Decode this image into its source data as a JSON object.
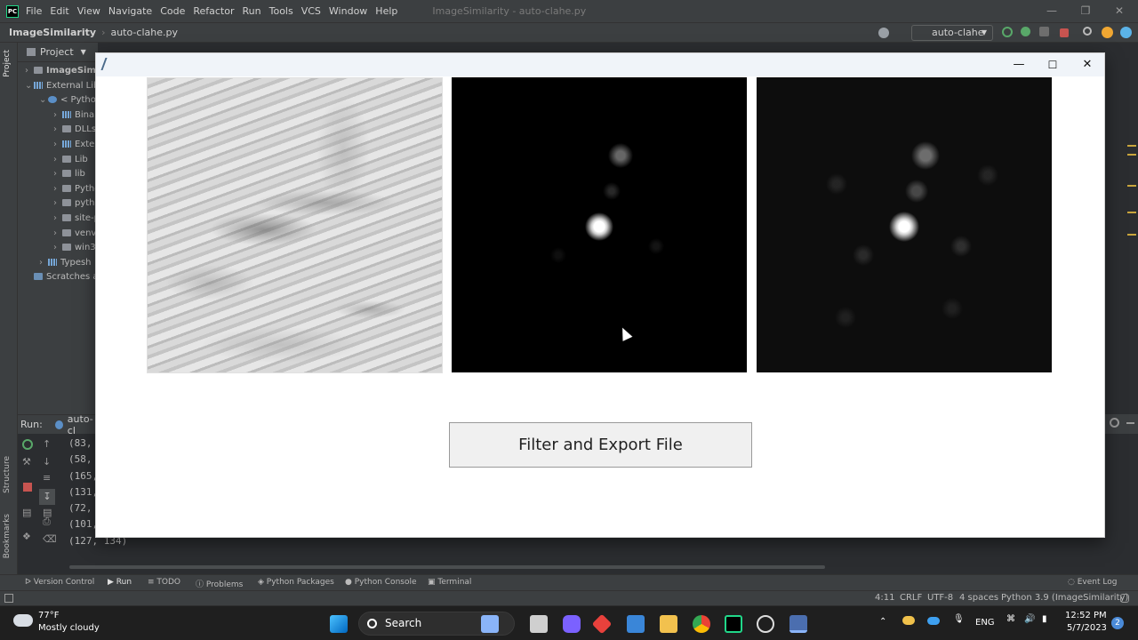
{
  "ide": {
    "menu": [
      "File",
      "Edit",
      "View",
      "Navigate",
      "Code",
      "Refactor",
      "Run",
      "Tools",
      "VCS",
      "Window",
      "Help"
    ],
    "window_title": "ImageSimilarity - auto-clahe.py",
    "breadcrumb_project": "ImageSimilarity",
    "breadcrumb_file": "auto-clahe.py",
    "run_config": "auto-clahe",
    "project_label": "Project",
    "side_tab_project": "Project",
    "side_tab_structure": "Structure",
    "side_tab_bookmarks": "Bookmarks",
    "tree": [
      {
        "label": "ImageSimil",
        "depth": 0,
        "icon": "folder",
        "bold": true
      },
      {
        "label": "External Libr",
        "depth": 0,
        "icon": "lib",
        "open": true
      },
      {
        "label": "< Python",
        "depth": 1,
        "icon": "python",
        "open": true
      },
      {
        "label": "Binar",
        "depth": 2,
        "icon": "lib"
      },
      {
        "label": "DLLs",
        "depth": 2,
        "icon": "folder"
      },
      {
        "label": "Extern",
        "depth": 2,
        "icon": "lib"
      },
      {
        "label": "Lib",
        "depth": 2,
        "icon": "folder"
      },
      {
        "label": "lib",
        "depth": 2,
        "icon": "folder"
      },
      {
        "label": "Pytho",
        "depth": 2,
        "icon": "folder"
      },
      {
        "label": "pytho",
        "depth": 2,
        "icon": "folder"
      },
      {
        "label": "site-p",
        "depth": 2,
        "icon": "folder"
      },
      {
        "label": "venv",
        "depth": 2,
        "icon": "folder"
      },
      {
        "label": "win32",
        "depth": 2,
        "icon": "folder"
      },
      {
        "label": "Typesh",
        "depth": 1,
        "icon": "lib"
      },
      {
        "label": "Scratches an",
        "depth": 0,
        "icon": "scratch"
      }
    ],
    "run_label": "Run:",
    "run_tab": "auto-cl",
    "run_output": [
      "(83,",
      "(58,",
      "(165,",
      "(131,",
      "(72,",
      "(101,",
      "(127, 134)"
    ],
    "tool_tabs": [
      "Version Control",
      "Run",
      "TODO",
      "Problems",
      "Python Packages",
      "Python Console",
      "Terminal"
    ],
    "active_tool_tab": "Run",
    "event_log": "Event Log",
    "status": {
      "position": "4:11",
      "line_sep": "CRLF",
      "encoding": "UTF-8",
      "indent": "4 spaces",
      "interpreter": "Python 3.9 (ImageSimilarity)"
    }
  },
  "app_window": {
    "images": [
      "original-image",
      "fft-spectrum-image",
      "enhanced-spectrum-image"
    ],
    "export_button": "Filter and Export File"
  },
  "taskbar": {
    "weather_temp": "77°F",
    "weather_desc": "Mostly cloudy",
    "search": "Search",
    "lang": "ENG",
    "time": "12:52 PM",
    "date": "5/7/2023",
    "notification_count": "2"
  }
}
